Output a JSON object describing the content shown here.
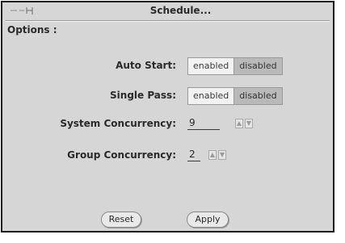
{
  "window": {
    "title": "Schedule..."
  },
  "options_label": "Options :",
  "rows": {
    "auto_start": {
      "label": "Auto Start:",
      "enabled": "enabled",
      "disabled": "disabled",
      "selected": "disabled"
    },
    "single_pass": {
      "label": "Single Pass:",
      "enabled": "enabled",
      "disabled": "disabled",
      "selected": "disabled"
    },
    "system_concurrency": {
      "label": "System Concurrency:",
      "value": "9"
    },
    "group_concurrency": {
      "label": "Group Concurrency:",
      "value": "2"
    }
  },
  "buttons": {
    "reset": "Reset",
    "apply": "Apply"
  },
  "icons": {
    "pin": "pushpin-icon",
    "increment": "up-arrow-icon",
    "decrement": "down-arrow-icon"
  }
}
